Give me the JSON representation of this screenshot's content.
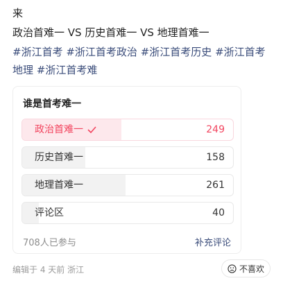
{
  "post": {
    "text": "来",
    "title": "政治首难一 VS 历史首难一 VS 地理首难一",
    "tags": [
      "#浙江首考",
      "#浙江首考政治",
      "#浙江首考历史",
      "#浙江首考地理",
      "#浙江首考难"
    ]
  },
  "poll": {
    "title": "谁是首考难一",
    "options": [
      {
        "label": "政治首难一",
        "count": "249",
        "selected": true,
        "share": 0.47
      },
      {
        "label": "历史首难一",
        "count": "158",
        "selected": false,
        "share": 0.3
      },
      {
        "label": "地理首难一",
        "count": "261",
        "selected": false,
        "share": 0.49
      },
      {
        "label": "评论区",
        "count": "40",
        "selected": false,
        "share": 0.08
      }
    ],
    "participants": "708人已参与",
    "add_comment": "补充评论"
  },
  "meta": {
    "edited": "编辑于 4 天前 浙江",
    "dislike": "不喜欢"
  },
  "colors": {
    "accent": "#f2455f",
    "tag": "#3a4c7a"
  }
}
